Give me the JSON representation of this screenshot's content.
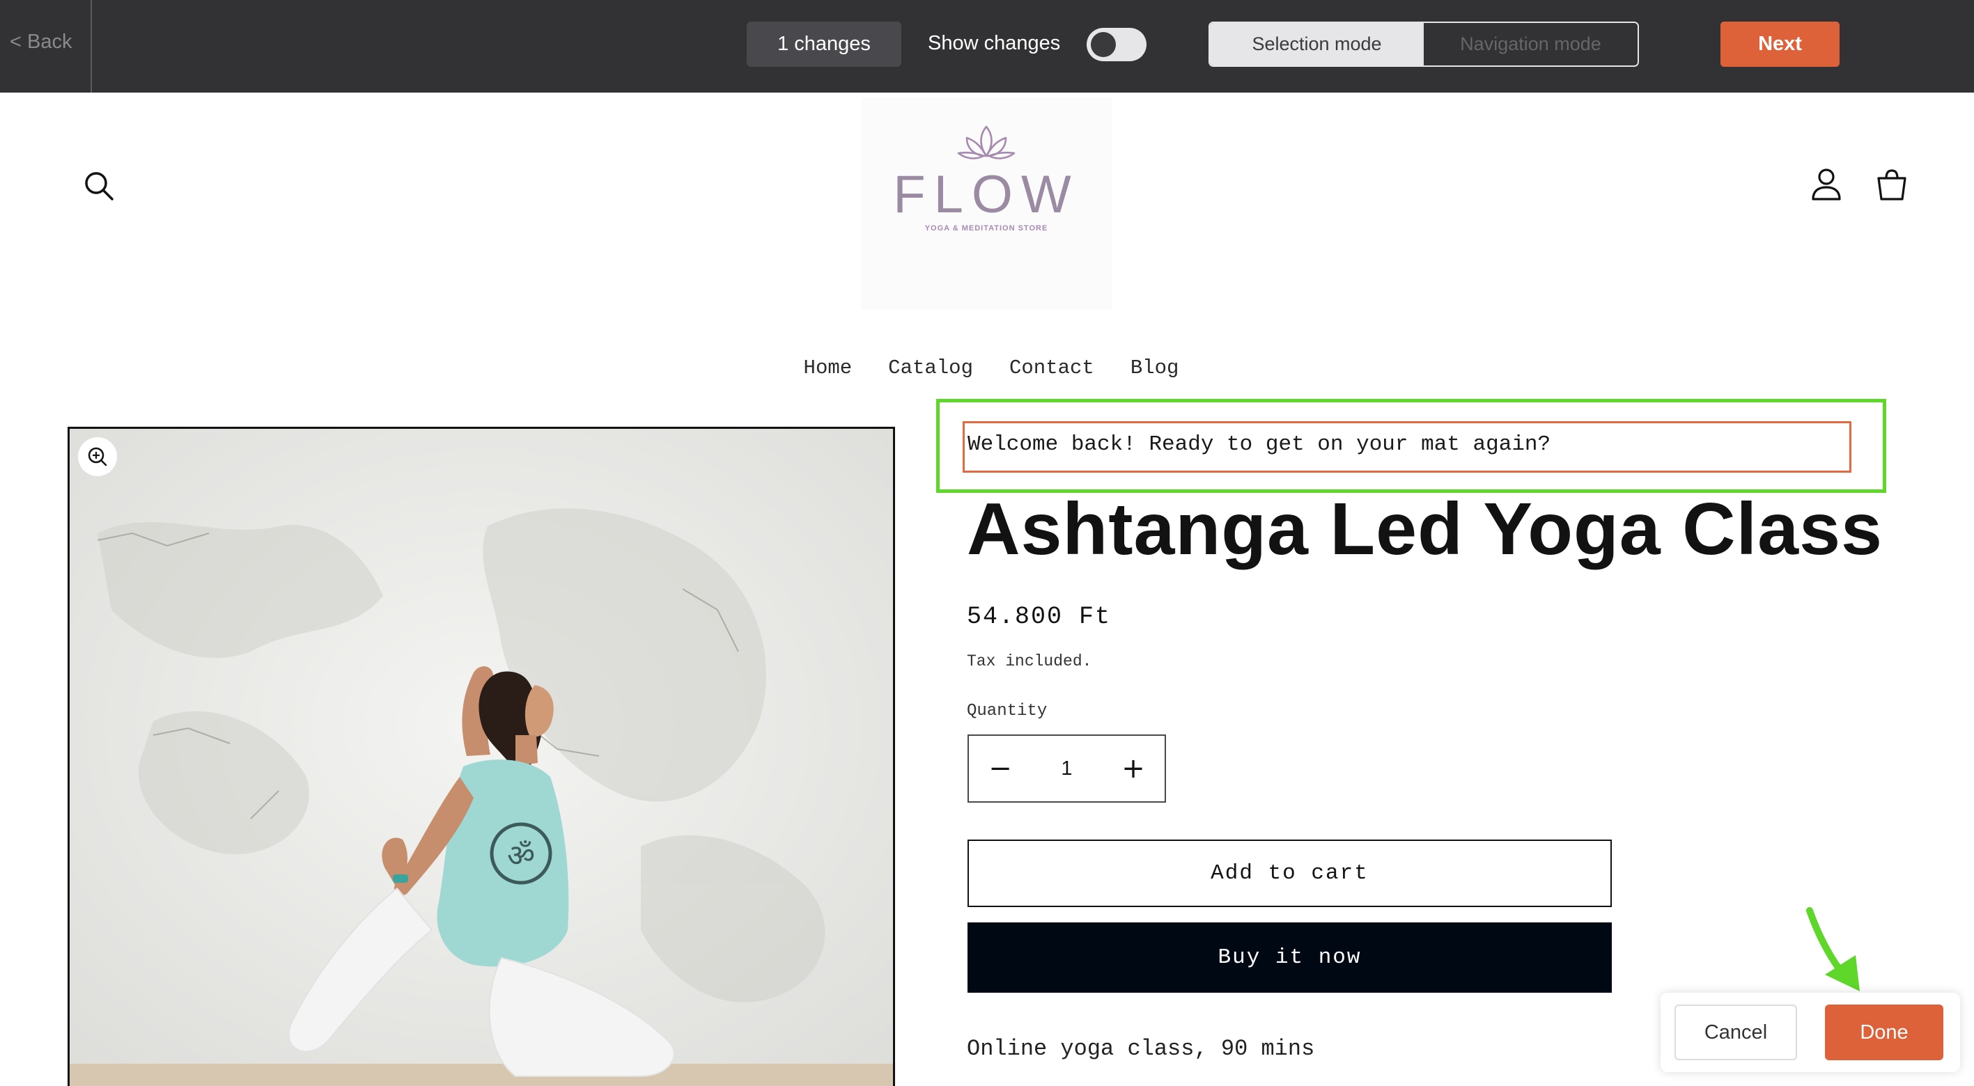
{
  "toolbar": {
    "back_label": "< Back",
    "changes_label": "1 changes",
    "show_changes_label": "Show changes",
    "show_changes_on": false,
    "modes": [
      "Selection mode",
      "Navigation mode"
    ],
    "active_mode": "Selection mode",
    "next_label": "Next"
  },
  "header": {
    "logo_word": "FLOW",
    "logo_subtitle": "YOGA & MEDITATION STORE",
    "icons": [
      "search-icon",
      "account-icon",
      "cart-icon"
    ]
  },
  "nav": {
    "items": [
      "Home",
      "Catalog",
      "Contact",
      "Blog"
    ]
  },
  "product": {
    "welcome_text": "Welcome back! Ready to get on your mat again?",
    "title": "Ashtanga Led Yoga Class",
    "price": "54.800 Ft",
    "tax_note": "Tax included.",
    "quantity_label": "Quantity",
    "quantity_value": "1",
    "decrease_symbol": "−",
    "increase_symbol": "+",
    "add_to_cart_label": "Add to cart",
    "buy_now_label": "Buy it now",
    "description": "Online yoga class, 90 mins"
  },
  "edit_panel": {
    "cancel_label": "Cancel",
    "done_label": "Done"
  },
  "colors": {
    "toolbar_bg": "#323235",
    "accent_orange": "#dd6139",
    "selection_green": "#5ed62a",
    "selection_inner": "#e26a42",
    "logo_purple": "#9a8aa2",
    "buy_now_bg": "#000814"
  }
}
